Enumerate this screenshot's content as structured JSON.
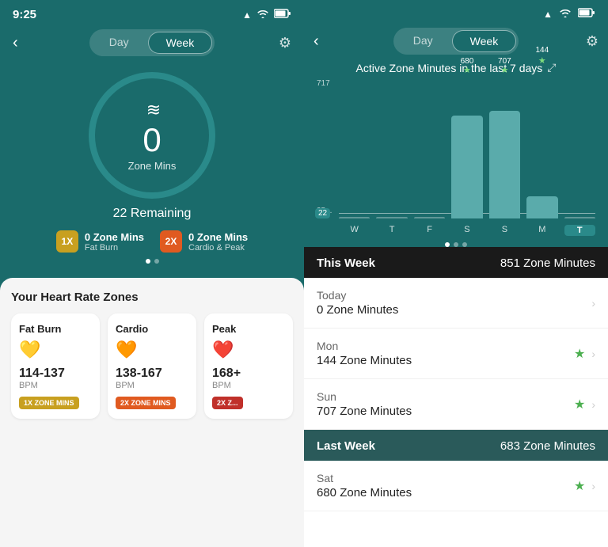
{
  "left": {
    "status": {
      "time": "9:25",
      "signal_icon": "▲",
      "wifi_icon": "wifi",
      "battery_icon": "battery"
    },
    "nav": {
      "back_label": "‹",
      "segment_day": "Day",
      "segment_week": "Week",
      "gear": "⚙"
    },
    "circle": {
      "waves": "≋",
      "value": "0",
      "unit": "Zone Mins",
      "remaining": "22 Remaining"
    },
    "badges": [
      {
        "id": "1x",
        "label": "1X",
        "mins": "0 Zone Mins",
        "type": "Fat Burn"
      },
      {
        "id": "2x",
        "label": "2X",
        "mins": "0 Zone Mins",
        "type": "Cardio & Peak"
      }
    ],
    "hr_title": "Your Heart Rate Zones",
    "hr_cards": [
      {
        "title": "Fat Burn",
        "emoji": "💛",
        "range": "114-137",
        "unit": "BPM",
        "zone_label": "1X ZONE MINS",
        "zone_color": "zone-1x-color"
      },
      {
        "title": "Cardio",
        "emoji": "🧡",
        "range": "138-167",
        "unit": "BPM",
        "zone_label": "2X ZONE MINS",
        "zone_color": "zone-2x-orange"
      },
      {
        "title": "Peak",
        "emoji": "❤️",
        "range": "168+",
        "unit": "BPM",
        "zone_label": "2X Z...",
        "zone_color": "zone-2x-red"
      }
    ]
  },
  "right": {
    "nav": {
      "back_label": "‹",
      "segment_day": "Day",
      "segment_week": "Week",
      "gear": "⚙"
    },
    "chart": {
      "title": "Active Zone Minutes in the last 7 days",
      "expand_icon": "⤢",
      "y_max": "717",
      "y_mid": "35...",
      "goal": "22",
      "bars": [
        {
          "day": "W",
          "value": 0,
          "height_pct": 0,
          "highlight": false,
          "show_star": false
        },
        {
          "day": "T",
          "value": 0,
          "height_pct": 0,
          "highlight": false,
          "show_star": false
        },
        {
          "day": "F",
          "value": 0,
          "height_pct": 0,
          "highlight": false,
          "show_star": false
        },
        {
          "day": "S",
          "value": 680,
          "height_pct": 74,
          "highlight": true,
          "show_star": true,
          "label": "680"
        },
        {
          "day": "S",
          "value": 707,
          "height_pct": 77,
          "highlight": true,
          "show_star": true,
          "label": "707"
        },
        {
          "day": "M",
          "value": 144,
          "height_pct": 16,
          "highlight": true,
          "show_star": true,
          "label": "144"
        },
        {
          "day": "T",
          "value": 0,
          "height_pct": 0,
          "highlight": false,
          "show_star": false,
          "today": true
        }
      ]
    },
    "this_week": {
      "label": "This Week",
      "value": "851 Zone Minutes"
    },
    "list_items": [
      {
        "day": "Today",
        "value": "0 Zone Minutes",
        "star": false,
        "chevron": true
      },
      {
        "day": "Mon",
        "value": "144 Zone Minutes",
        "star": true,
        "chevron": true
      },
      {
        "day": "Sun",
        "value": "707 Zone Minutes",
        "star": true,
        "chevron": true
      }
    ],
    "last_week": {
      "label": "Last Week",
      "value": "683 Zone Minutes"
    },
    "last_week_items": [
      {
        "day": "Sat",
        "value": "680 Zone Minutes",
        "star": true,
        "chevron": true
      }
    ]
  }
}
